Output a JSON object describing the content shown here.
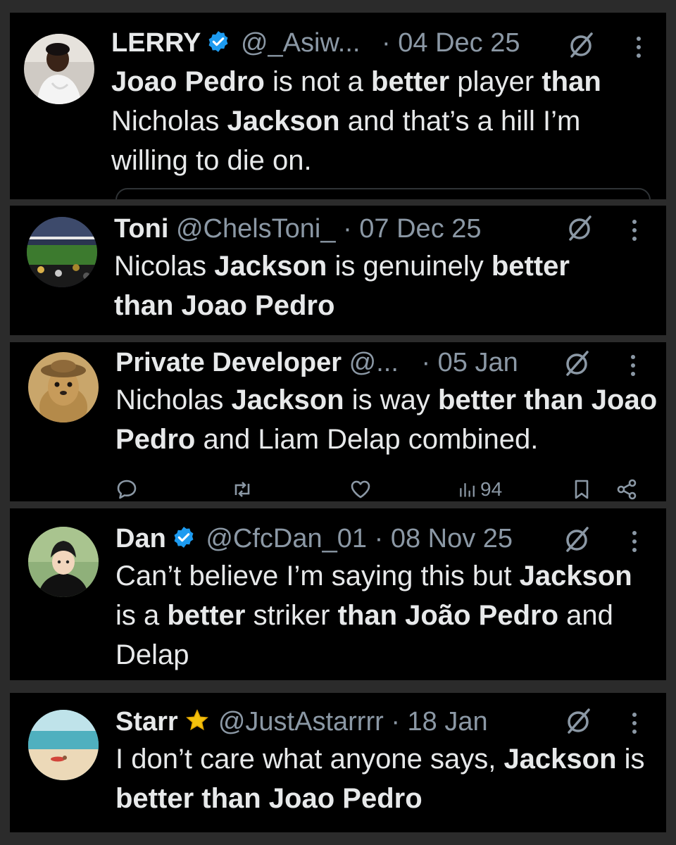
{
  "colors": {
    "background": "#000000",
    "text": "#e7e9ea",
    "secondary": "#8b98a5",
    "verified": "#1d9bf0",
    "star": "#f4c20d"
  },
  "tweets": [
    {
      "name": "LERRY",
      "verified": true,
      "handle": "@_Asiw...",
      "date": "· 04 Dec 25",
      "segments": [
        {
          "t": "Joao Pedro",
          "b": true
        },
        {
          "t": " is not a ",
          "b": false
        },
        {
          "t": "better",
          "b": true
        },
        {
          "t": " player ",
          "b": false
        },
        {
          "t": "than",
          "b": true
        },
        {
          "t": " Nicholas ",
          "b": false
        },
        {
          "t": "Jackson",
          "b": true
        },
        {
          "t": " and that’s a hill I’m willing to die on.",
          "b": false
        }
      ]
    },
    {
      "name": "Toni",
      "verified": false,
      "handle": "@ChelsToni_",
      "date": "· 07 Dec 25",
      "segments": [
        {
          "t": "Nicolas ",
          "b": false
        },
        {
          "t": "Jackson",
          "b": true
        },
        {
          "t": " is genuinely ",
          "b": false
        },
        {
          "t": "better than Joao Pedro",
          "b": true
        }
      ]
    },
    {
      "name": "Private Developer",
      "verified": false,
      "handle": "@...",
      "date": "· 05 Jan",
      "segments": [
        {
          "t": "Nicholas ",
          "b": false
        },
        {
          "t": "Jackson",
          "b": true
        },
        {
          "t": " is way ",
          "b": false
        },
        {
          "t": "better than Joao Pedro",
          "b": true
        },
        {
          "t": " and Liam Delap combined.",
          "b": false
        }
      ],
      "actions": {
        "views": "94"
      }
    },
    {
      "name": "Dan",
      "verified": true,
      "handle": "@CfcDan_01",
      "date": "· 08 Nov 25",
      "segments": [
        {
          "t": "Can’t believe I’m saying this but ",
          "b": false
        },
        {
          "t": "Jackson",
          "b": true
        },
        {
          "t": " is a ",
          "b": false
        },
        {
          "t": "better",
          "b": true
        },
        {
          "t": " striker ",
          "b": false
        },
        {
          "t": "than João Pedro",
          "b": true
        },
        {
          "t": " and Delap",
          "b": false
        }
      ]
    },
    {
      "name": "Starr",
      "verified": false,
      "emoji": "⭐",
      "handle": "@JustAstarrrr",
      "date": "· 18 Jan",
      "segments": [
        {
          "t": "I don’t care what anyone says, ",
          "b": false
        },
        {
          "t": "Jackson",
          "b": true
        },
        {
          "t": " is ",
          "b": false
        },
        {
          "t": "better than Joao Pedro",
          "b": true
        }
      ]
    }
  ]
}
